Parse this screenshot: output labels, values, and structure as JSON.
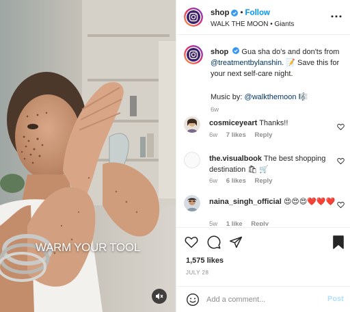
{
  "post": {
    "account": {
      "username": "shop",
      "follow_label": "Follow",
      "dot": "•"
    },
    "audio": {
      "artist": "WALK THE MOON",
      "sep": "•",
      "track": "Giants"
    },
    "media": {
      "overlay_text": "WARM YOUR TOOL",
      "mute_icon": "mute-icon"
    },
    "caption": {
      "username": "shop",
      "text_before": "Gua sha do's and don'ts from",
      "mention": "@treatmentbylanshin.",
      "text_after": "📝 Save this for your next self-care night.",
      "music_label": "Music by:",
      "music_mention": "@walkthemoon",
      "music_emoji": "🎼",
      "time": "6w"
    },
    "comments": [
      {
        "username": "cosmiceyeart",
        "text": "Thanks!!",
        "time": "6w",
        "likes": "7 likes",
        "reply": "Reply"
      },
      {
        "username": "the.visualbook",
        "text": "The best shopping destination 🛍 🛒",
        "time": "6w",
        "likes": "6 likes",
        "reply": "Reply"
      },
      {
        "username": "naina_singh_official",
        "text": "😍😍😍❤️❤️❤️",
        "time": "5w",
        "likes": "1 like",
        "reply": "Reply"
      }
    ],
    "likes_count": "1,575 likes",
    "date": "JULY 28",
    "add_comment": {
      "placeholder": "Add a comment...",
      "post_label": "Post"
    },
    "colors": {
      "accent": "#0095f6",
      "post_disabled": "#b2dffc",
      "muted": "#8e8e8e",
      "link": "#00376b"
    }
  }
}
